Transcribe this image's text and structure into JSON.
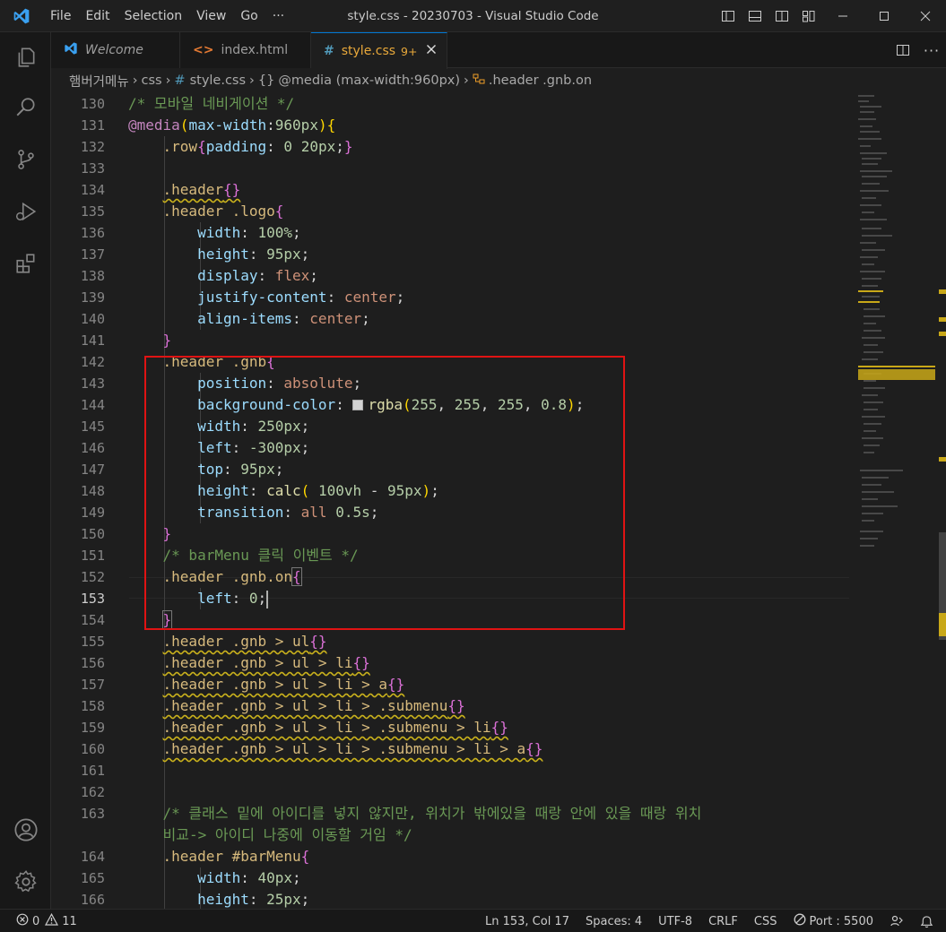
{
  "titlebar": {
    "menu": [
      "File",
      "Edit",
      "Selection",
      "View",
      "Go",
      "···"
    ],
    "title": "style.css - 20230703 - Visual Studio Code"
  },
  "tabs": [
    {
      "label": "Welcome",
      "icon": "vscode-icon"
    },
    {
      "label": "index.html",
      "icon": "html-icon"
    },
    {
      "label": "style.css",
      "icon": "css-icon",
      "badge": "9+",
      "active": true
    }
  ],
  "breadcrumb": [
    "햄버거메뉴",
    "css",
    "style.css",
    "@media (max-width:960px)",
    ".header .gnb.on"
  ],
  "editor": {
    "line_numbers": [
      "130",
      "131",
      "132",
      "133",
      "134",
      "135",
      "136",
      "137",
      "138",
      "139",
      "140",
      "141",
      "142",
      "143",
      "144",
      "145",
      "146",
      "147",
      "148",
      "149",
      "150",
      "151",
      "152",
      "153",
      "154",
      "155",
      "156",
      "157",
      "158",
      "159",
      "160",
      "161",
      "162",
      "163",
      "",
      "164",
      "165",
      "166"
    ],
    "current_line": "153",
    "wrap_comment_1": "/* 클래스 밑에 아이디를 넣지 않지만, 위치가 밖에있을 때랑 안에 있을 때랑 위치",
    "wrap_comment_2": "비교-> 아이디 나중에 이동할 거임 */",
    "comment_mobile_nav": "/* 모바일 네비게이션 */",
    "comment_barmenu": "/* barMenu 클릭 이벤트 */"
  },
  "status": {
    "errors": "0",
    "warnings": "11",
    "position": "Ln 153, Col 17",
    "spaces": "Spaces: 4",
    "encoding": "UTF-8",
    "eol": "CRLF",
    "language": "CSS",
    "port": "Port : 5500"
  },
  "colors": {
    "accent": "#0078d4",
    "highlight_box": "#e01313",
    "active_tab_text": "#e8a83a"
  }
}
